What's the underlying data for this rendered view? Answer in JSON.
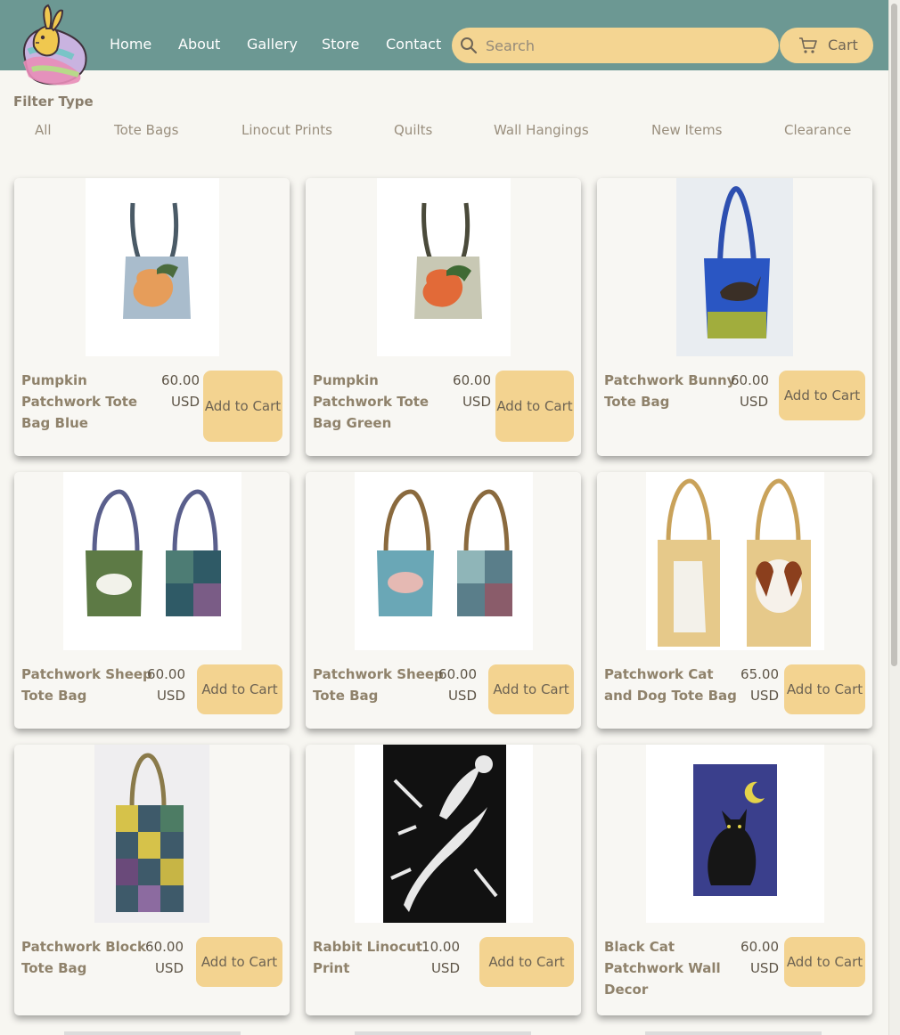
{
  "nav": {
    "items": [
      "Home",
      "About",
      "Gallery",
      "Store",
      "Contact"
    ]
  },
  "search": {
    "placeholder": "Search"
  },
  "cart": {
    "label": "Cart"
  },
  "filter": {
    "title": "Filter Type",
    "options": [
      "All",
      "Tote Bags",
      "Linocut Prints",
      "Quilts",
      "Wall Hangings",
      "New Items",
      "Clearance"
    ]
  },
  "products": [
    {
      "name": "Pumpkin Patchwork Tote Bag Blue",
      "price": "60.00 USD",
      "button": "Add to Cart"
    },
    {
      "name": "Pumpkin Patchwork Tote Bag Green",
      "price": "60.00 USD",
      "button": "Add to Cart"
    },
    {
      "name": "Patchwork Bunny Tote Bag",
      "price": "60.00 USD",
      "button": "Add to Cart"
    },
    {
      "name": "Patchwork Sheep Tote Bag",
      "price": "60.00 USD",
      "button": "Add to Cart"
    },
    {
      "name": "Patchwork Sheep Tote Bag",
      "price": "60.00 USD",
      "button": "Add to Cart"
    },
    {
      "name": "Patchwork Cat and Dog Tote Bag",
      "price": "65.00 USD",
      "button": "Add to Cart"
    },
    {
      "name": "Patchwork Block Tote Bag",
      "price": "60.00 USD",
      "button": "Add to Cart"
    },
    {
      "name": "Rabbit Linocut Print",
      "price": "10.00 USD",
      "button": "Add to Cart"
    },
    {
      "name": "Black Cat Patchwork Wall Decor",
      "price": "60.00 USD",
      "button": "Add to Cart"
    }
  ],
  "colors": {
    "header": "#6c9893",
    "accent": "#f4d592",
    "background": "#f7f6f1"
  }
}
